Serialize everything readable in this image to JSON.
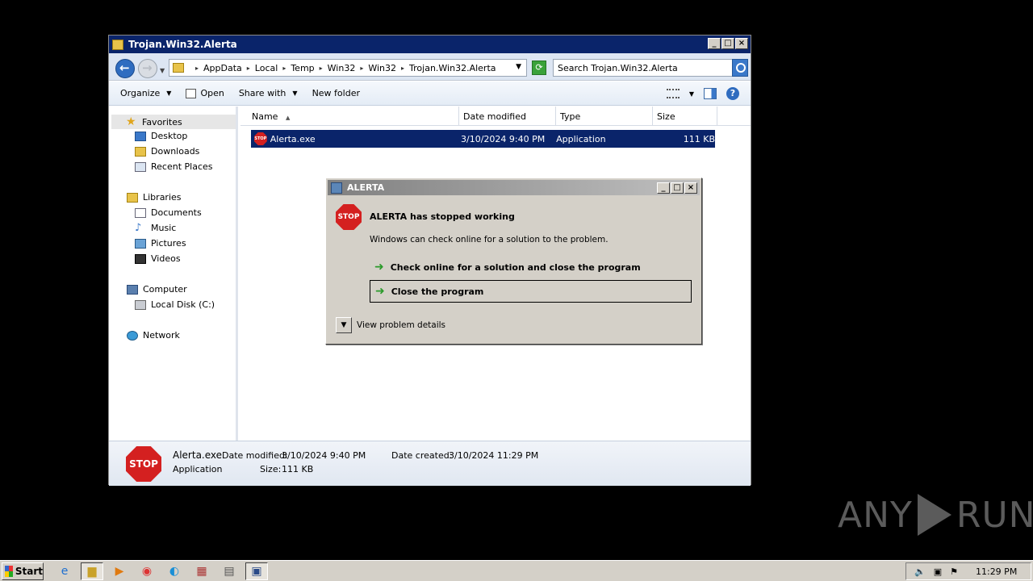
{
  "explorer": {
    "title": "Trojan.Win32.Alerta",
    "breadcrumb": [
      "AppData",
      "Local",
      "Temp",
      "Win32",
      "Win32",
      "Trojan.Win32.Alerta"
    ],
    "search_placeholder": "Search Trojan.Win32.Alerta",
    "toolbar": {
      "organize": "Organize",
      "open": "Open",
      "share_with": "Share with",
      "new_folder": "New folder"
    },
    "nav": {
      "favorites": "Favorites",
      "desktop": "Desktop",
      "downloads": "Downloads",
      "recent_places": "Recent Places",
      "libraries": "Libraries",
      "documents": "Documents",
      "music": "Music",
      "pictures": "Pictures",
      "videos": "Videos",
      "computer": "Computer",
      "local_disk": "Local Disk (C:)",
      "network": "Network"
    },
    "columns": {
      "name": "Name",
      "date_modified": "Date modified",
      "type": "Type",
      "size": "Size"
    },
    "files": [
      {
        "name": "Alerta.exe",
        "date_modified": "3/10/2024 9:40 PM",
        "type": "Application",
        "size": "111 KB"
      }
    ],
    "details": {
      "filename": "Alerta.exe",
      "type": "Application",
      "date_modified_label": "Date modified:",
      "date_modified": "3/10/2024 9:40 PM",
      "size_label": "Size:",
      "size": "111 KB",
      "date_created_label": "Date created:",
      "date_created": "3/10/2024 11:29 PM",
      "icon_text": "STOP"
    }
  },
  "dialog": {
    "title": "ALERTA",
    "stop_text": "STOP",
    "heading": "ALERTA has stopped working",
    "subtext": "Windows can check online for a solution to the problem.",
    "option_check_online": "Check online for a solution and close the program",
    "option_close": "Close the program",
    "view_details": "View problem details"
  },
  "taskbar": {
    "start": "Start",
    "clock": "11:29 PM"
  },
  "watermark": {
    "left": "ANY",
    "right": "RUN"
  },
  "colors": {
    "selection": "#0a246a",
    "stop_red": "#d42020",
    "dialog_face": "#d4d0c8"
  }
}
